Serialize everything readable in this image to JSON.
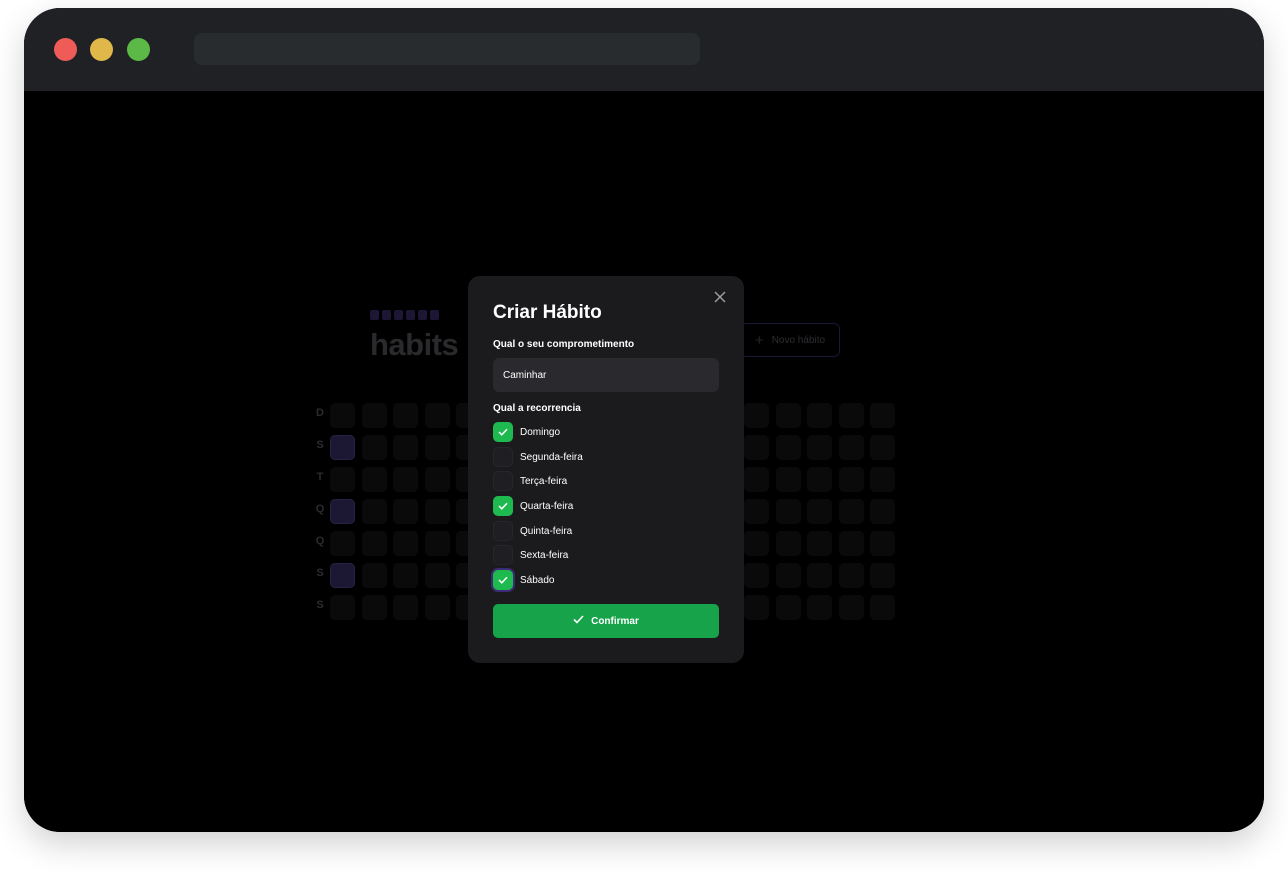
{
  "background": {
    "logo_text": "habits",
    "new_habit_label": "Novo hábito",
    "weekdays": [
      "D",
      "S",
      "T",
      "Q",
      "Q",
      "S",
      "S"
    ]
  },
  "modal": {
    "title": "Criar Hábito",
    "commitment_label": "Qual o seu comprometimento",
    "commitment_value": "Caminhar",
    "recurrence_label": "Qual a recorrencia",
    "days": [
      {
        "label": "Domingo",
        "checked": true
      },
      {
        "label": "Segunda-feira",
        "checked": false
      },
      {
        "label": "Terça-feira",
        "checked": false
      },
      {
        "label": "Quarta-feira",
        "checked": true
      },
      {
        "label": "Quinta-feira",
        "checked": false
      },
      {
        "label": "Sexta-feira",
        "checked": false
      },
      {
        "label": "Sábado",
        "checked": true
      }
    ],
    "confirm_label": "Confirmar"
  },
  "colors": {
    "accent_green": "#16a34a",
    "checkbox_green": "#1fba4f",
    "purple_cell": "#1c1732"
  }
}
